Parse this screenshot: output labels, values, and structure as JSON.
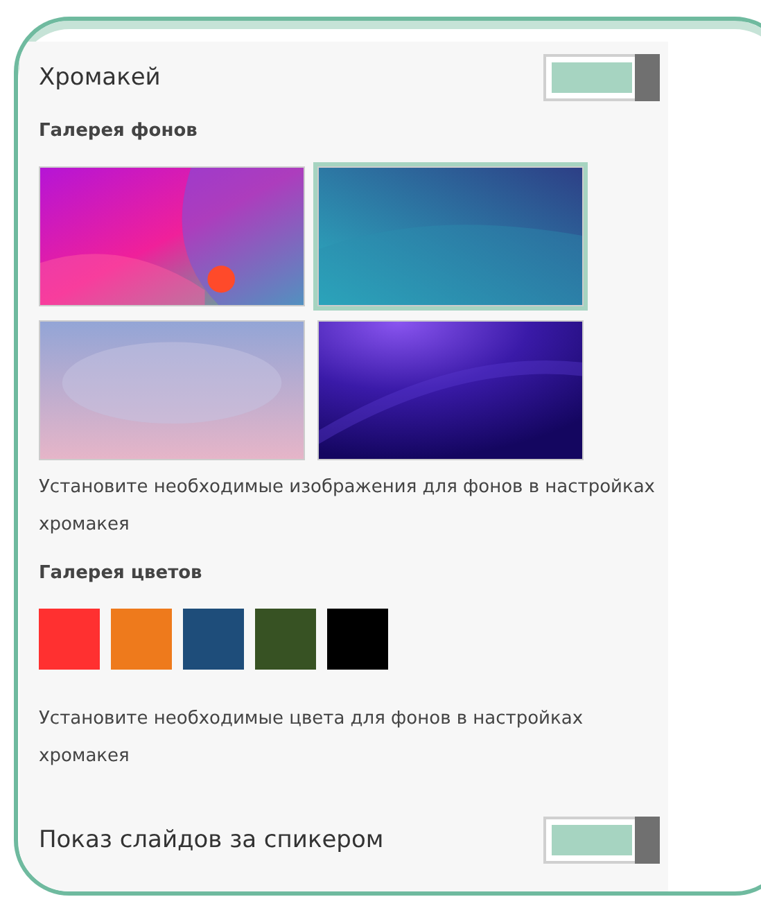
{
  "chromakey": {
    "title": "Хромакей",
    "on": true
  },
  "backgrounds": {
    "title": "Галерея фонов",
    "items": [
      {
        "kind": "picture",
        "selected": false
      },
      {
        "kind": "picture",
        "selected": true
      },
      {
        "kind": "picture",
        "selected": false
      },
      {
        "kind": "picture",
        "selected": false
      }
    ],
    "hint": "Установите необходимые изображения для фонов в настройках хромакея"
  },
  "colors": {
    "title": "Галерея цветов",
    "items": [
      {
        "color": "#ff3030"
      },
      {
        "color": "#ee7a1c"
      },
      {
        "color": "#1e4d7a"
      },
      {
        "color": "#375223"
      },
      {
        "color": "#000000"
      }
    ],
    "hint": "Установите необходимые цвета для фонов в настройках хромакея"
  },
  "slides_behind_speaker": {
    "title": "Показ слайдов за спикером",
    "on": true
  }
}
